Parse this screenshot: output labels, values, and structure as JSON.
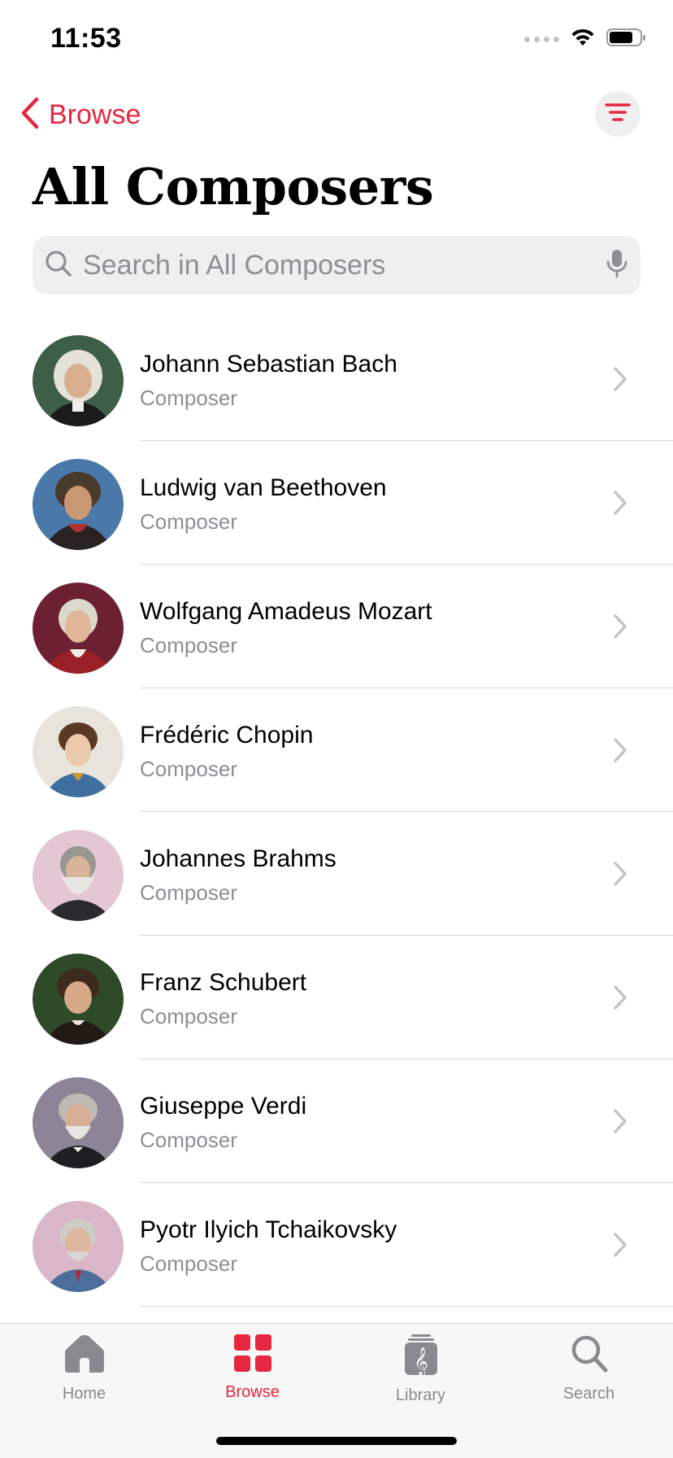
{
  "status_bar": {
    "time": "11:53"
  },
  "nav": {
    "back_label": "Browse",
    "title": "All Composers"
  },
  "search": {
    "placeholder": "Search in All Composers",
    "value": ""
  },
  "composers": [
    {
      "name": "Johann Sebastian Bach",
      "subtitle": "Composer"
    },
    {
      "name": "Ludwig van Beethoven",
      "subtitle": "Composer"
    },
    {
      "name": "Wolfgang Amadeus Mozart",
      "subtitle": "Composer"
    },
    {
      "name": "Frédéric Chopin",
      "subtitle": "Composer"
    },
    {
      "name": "Johannes Brahms",
      "subtitle": "Composer"
    },
    {
      "name": "Franz Schubert",
      "subtitle": "Composer"
    },
    {
      "name": "Giuseppe Verdi",
      "subtitle": "Composer"
    },
    {
      "name": "Pyotr Ilyich Tchaikovsky",
      "subtitle": "Composer"
    }
  ],
  "tabs": [
    {
      "label": "Home",
      "icon": "home-icon",
      "active": false
    },
    {
      "label": "Browse",
      "icon": "browse-grid-icon",
      "active": true
    },
    {
      "label": "Library",
      "icon": "library-icon",
      "active": false
    },
    {
      "label": "Search",
      "icon": "search-icon",
      "active": false
    }
  ],
  "colors": {
    "accent": "#e5273f",
    "secondary_text": "#8e8e93",
    "search_bg": "#efeff0"
  }
}
